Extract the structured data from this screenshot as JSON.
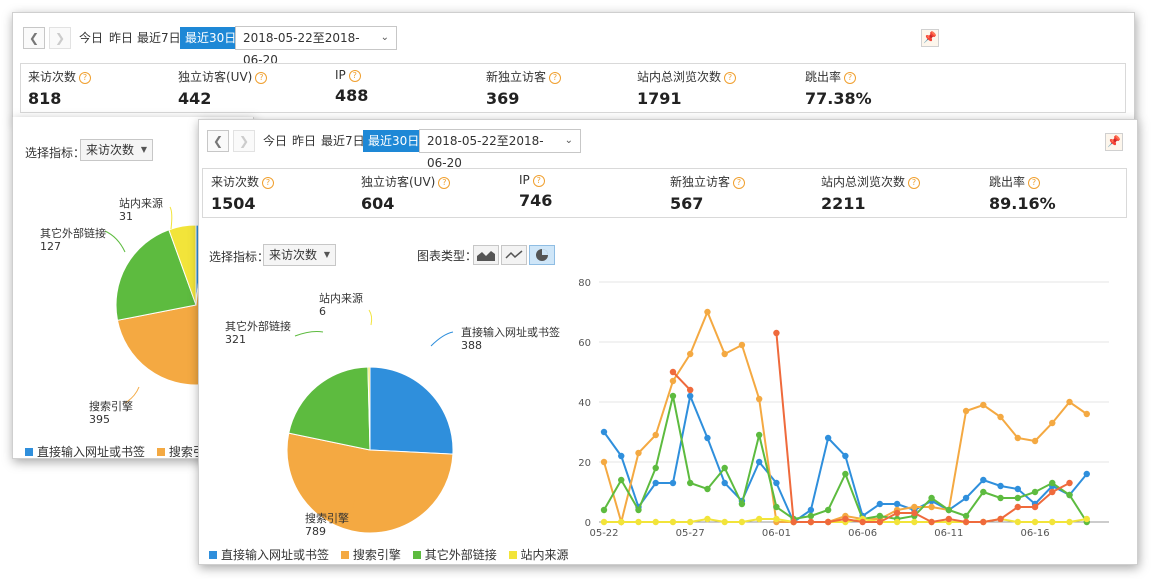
{
  "toolbar": {
    "today": "今日",
    "yesterday": "昨日",
    "last7": "最近7日",
    "last30": "最近30日",
    "range": "2018-05-22至2018-06-20"
  },
  "back": {
    "metrics": [
      {
        "label": "来访次数",
        "value": "818"
      },
      {
        "label": "独立访客(UV)",
        "value": "442"
      },
      {
        "label": "IP",
        "value": "488"
      },
      {
        "label": "新独立访客",
        "value": "369"
      },
      {
        "label": "站内总浏览次数",
        "value": "1791"
      },
      {
        "label": "跳出率",
        "value": "77.38%"
      }
    ],
    "select_label": "选择指标：",
    "select_value": "来访次数",
    "pie_labels": [
      {
        "name": "站内来源",
        "value": "31"
      },
      {
        "name": "其它外部链接",
        "value": "127"
      },
      {
        "name": "搜索引擎",
        "value": "395"
      }
    ],
    "legend": [
      "直接输入网址或书签",
      "搜索引擎"
    ]
  },
  "front": {
    "metrics": [
      {
        "label": "来访次数",
        "value": "1504"
      },
      {
        "label": "独立访客(UV)",
        "value": "604"
      },
      {
        "label": "IP",
        "value": "746"
      },
      {
        "label": "新独立访客",
        "value": "567"
      },
      {
        "label": "站内总浏览次数",
        "value": "2211"
      },
      {
        "label": "跳出率",
        "value": "89.16%"
      }
    ],
    "select_label": "选择指标：",
    "select_value": "来访次数",
    "chart_type_label": "图表类型：",
    "pie_labels": [
      {
        "name": "站内来源",
        "value": "6"
      },
      {
        "name": "直接输入网址或书签",
        "value": "388"
      },
      {
        "name": "其它外部链接",
        "value": "321"
      },
      {
        "name": "搜索引擎",
        "value": "789"
      }
    ],
    "legend": [
      "直接输入网址或书签",
      "搜索引擎",
      "其它外部链接",
      "站内来源"
    ]
  },
  "colors": {
    "direct": "#2f8fdc",
    "search": "#f4a942",
    "external": "#5dbb3f",
    "internal": "#f2e43a",
    "accent": "#1e88d6",
    "extra": "#ef6a3c"
  },
  "icons": [
    "chevron-left-icon",
    "chevron-right-icon",
    "pin-icon",
    "help-icon",
    "area-chart-icon",
    "line-chart-icon",
    "pie-chart-icon"
  ],
  "chart_data": [
    {
      "type": "pie",
      "title": "",
      "categories": [
        "直接输入网址或书签",
        "搜索引擎",
        "其它外部链接",
        "站内来源"
      ],
      "values": [
        388,
        789,
        321,
        6
      ]
    },
    {
      "type": "line",
      "title": "",
      "x": [
        "05-22",
        "05-23",
        "05-24",
        "05-25",
        "05-26",
        "05-27",
        "05-28",
        "05-29",
        "05-30",
        "05-31",
        "06-01",
        "06-02",
        "06-03",
        "06-04",
        "06-05",
        "06-06",
        "06-07",
        "06-08",
        "06-09",
        "06-10",
        "06-11",
        "06-12",
        "06-13",
        "06-14",
        "06-15",
        "06-16",
        "06-17",
        "06-18",
        "06-19",
        "06-20"
      ],
      "x_tick_labels": [
        "05-22",
        "05-27",
        "06-01",
        "06-06",
        "06-11",
        "06-16"
      ],
      "ylim": [
        0,
        80
      ],
      "y_ticks": [
        0,
        20,
        40,
        60,
        80
      ],
      "grid": true,
      "series": [
        {
          "name": "直接输入网址或书签",
          "color": "#2f8fdc",
          "values": [
            30,
            22,
            5,
            13,
            13,
            42,
            28,
            13,
            7,
            20,
            13,
            0,
            4,
            28,
            22,
            2,
            6,
            6,
            4,
            7,
            4,
            8,
            14,
            12,
            11,
            6,
            12,
            9,
            16,
            null
          ]
        },
        {
          "name": "搜索引擎",
          "color": "#f4a942",
          "values": [
            20,
            0,
            23,
            29,
            47,
            56,
            70,
            56,
            59,
            41,
            0,
            0,
            0,
            0,
            2,
            1,
            1,
            4,
            5,
            5,
            4,
            37,
            39,
            35,
            28,
            27,
            33,
            40,
            36,
            null
          ]
        },
        {
          "name": "其它外部链接",
          "color": "#5dbb3f",
          "values": [
            4,
            14,
            4,
            18,
            42,
            13,
            11,
            18,
            6,
            29,
            5,
            1,
            2,
            4,
            16,
            1,
            2,
            1,
            2,
            8,
            4,
            2,
            10,
            8,
            8,
            10,
            13,
            9,
            0,
            null
          ]
        },
        {
          "name": "站内来源",
          "color": "#f2e43a",
          "values": [
            0,
            0,
            0,
            0,
            0,
            0,
            1,
            0,
            0,
            1,
            1,
            0,
            0,
            0,
            0,
            1,
            0,
            0,
            0,
            0,
            0,
            0,
            0,
            1,
            0,
            0,
            0,
            0,
            1,
            null
          ]
        },
        {
          "name": "",
          "color": "#ef6a3c",
          "values": [
            null,
            null,
            null,
            null,
            50,
            44,
            null,
            null,
            null,
            null,
            63,
            0,
            0,
            0,
            1,
            0,
            0,
            3,
            3,
            0,
            1,
            0,
            0,
            1,
            5,
            5,
            10,
            13,
            null,
            null
          ]
        }
      ]
    }
  ]
}
